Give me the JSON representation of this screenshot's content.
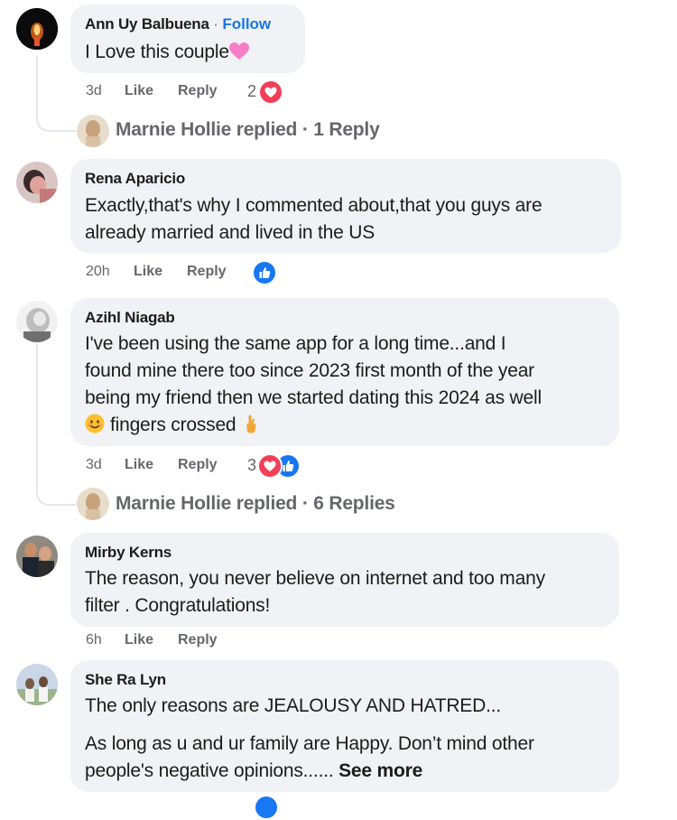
{
  "comments": [
    {
      "author": "Ann Uy Balbuena",
      "follow_sep": "·",
      "follow": "Follow",
      "text": "I Love this couple",
      "text_emoji": "pink-heart",
      "time": "3d",
      "like": "Like",
      "reply": "Reply",
      "reaction_count": "2",
      "reactions": [
        "love-reaction-icon"
      ],
      "replies_line": "Marnie Hollie replied · 1 Reply"
    },
    {
      "author": "Rena Aparicio",
      "text_lines": [
        "Exactly,that's why I commented about,that you guys are",
        "already married and lived in the US"
      ],
      "time": "20h",
      "like": "Like",
      "reply": "Reply",
      "reactions": [
        "like-reaction-icon"
      ]
    },
    {
      "author": "Azihl Niagab",
      "text_lines": [
        "I've been using the same app for a long time...and I",
        "found mine there too since 2023 first month of the year",
        "being my friend then we started dating this 2024 as well",
        "fingers crossed"
      ],
      "time": "3d",
      "like": "Like",
      "reply": "Reply",
      "reaction_count": "3",
      "reactions": [
        "love-reaction-icon",
        "like-reaction-icon"
      ],
      "replies_line": "Marnie Hollie replied · 6 Replies"
    },
    {
      "author": "Mirby Kerns",
      "text_lines": [
        "The reason, you never believe on internet and too many",
        "filter . Congratulations!"
      ],
      "time": "6h",
      "like": "Like",
      "reply": "Reply"
    },
    {
      "author": "She Ra Lyn",
      "text_lines": [
        "The only reasons are JEALOUSY AND HATRED...",
        "As long as u and ur family are Happy. Don’t mind other",
        "people's negative opinions......"
      ],
      "see_more": "See more"
    }
  ],
  "colors": {
    "bubble": "#f0f2f5",
    "meta": "#65676b",
    "link": "#1b74e4",
    "love": "#f33e58",
    "like": "#1877f2"
  }
}
